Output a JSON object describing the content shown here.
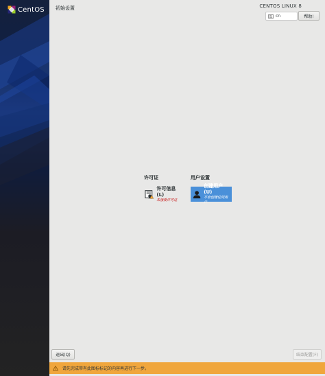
{
  "sidebar": {
    "logo_text": "CentOS"
  },
  "header": {
    "page_title": "初始设置",
    "product_name": "CENTOS LINUX 8",
    "keyboard_layout": "cn",
    "help_label": "帮助!"
  },
  "categories": [
    {
      "title": "许可证",
      "spokes": [
        {
          "name": "许可信息(L)",
          "status": "未接受许可证",
          "icon": "license-icon"
        }
      ]
    },
    {
      "title": "用户设置",
      "spokes": [
        {
          "name": "创建用户(U)",
          "status": "不会创建任何用户",
          "icon": "user-icon"
        }
      ]
    }
  ],
  "buttons": {
    "quit_label": "退出(Q)",
    "finish_label": "结束配置(F)"
  },
  "warning": {
    "message": "请先完成带有此图标标记的内容再进行下一步。",
    "icon": "warning-icon"
  },
  "colors": {
    "accent": "#4a90d9",
    "warning_bar": "#f0a63c",
    "error_text": "#c91c1c"
  }
}
